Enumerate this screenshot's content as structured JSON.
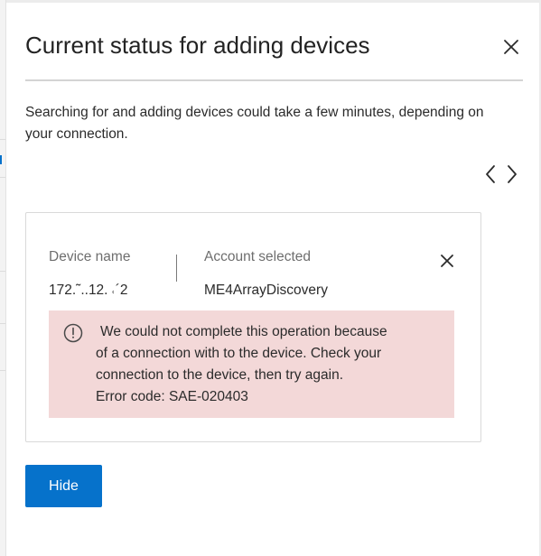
{
  "dialog": {
    "title": "Current status for adding devices",
    "description": "Searching for and adding devices could take a few minutes, depending on your connection.",
    "close_icon": "close-icon"
  },
  "pager": {
    "previous_icon": "chevron-left-icon",
    "next_icon": "chevron-right-icon"
  },
  "device_card": {
    "device_name_label": "Device name",
    "device_name_value": "172.˜..12. ˓´2",
    "account_label": "Account selected",
    "account_value": "ME4ArrayDiscovery",
    "dismiss_icon": "close-icon",
    "error": {
      "icon": "info-circle-icon",
      "lines": [
        "We could not complete this operation because",
        "of a connection with to the device. Check your",
        "connection to the device, then try again.",
        "Error code: SAE-020403"
      ],
      "background_color": "#f3d8d8"
    }
  },
  "actions": {
    "hide_label": "Hide"
  },
  "colors": {
    "accent": "#0672cb",
    "error_background": "#f3d8d8"
  }
}
